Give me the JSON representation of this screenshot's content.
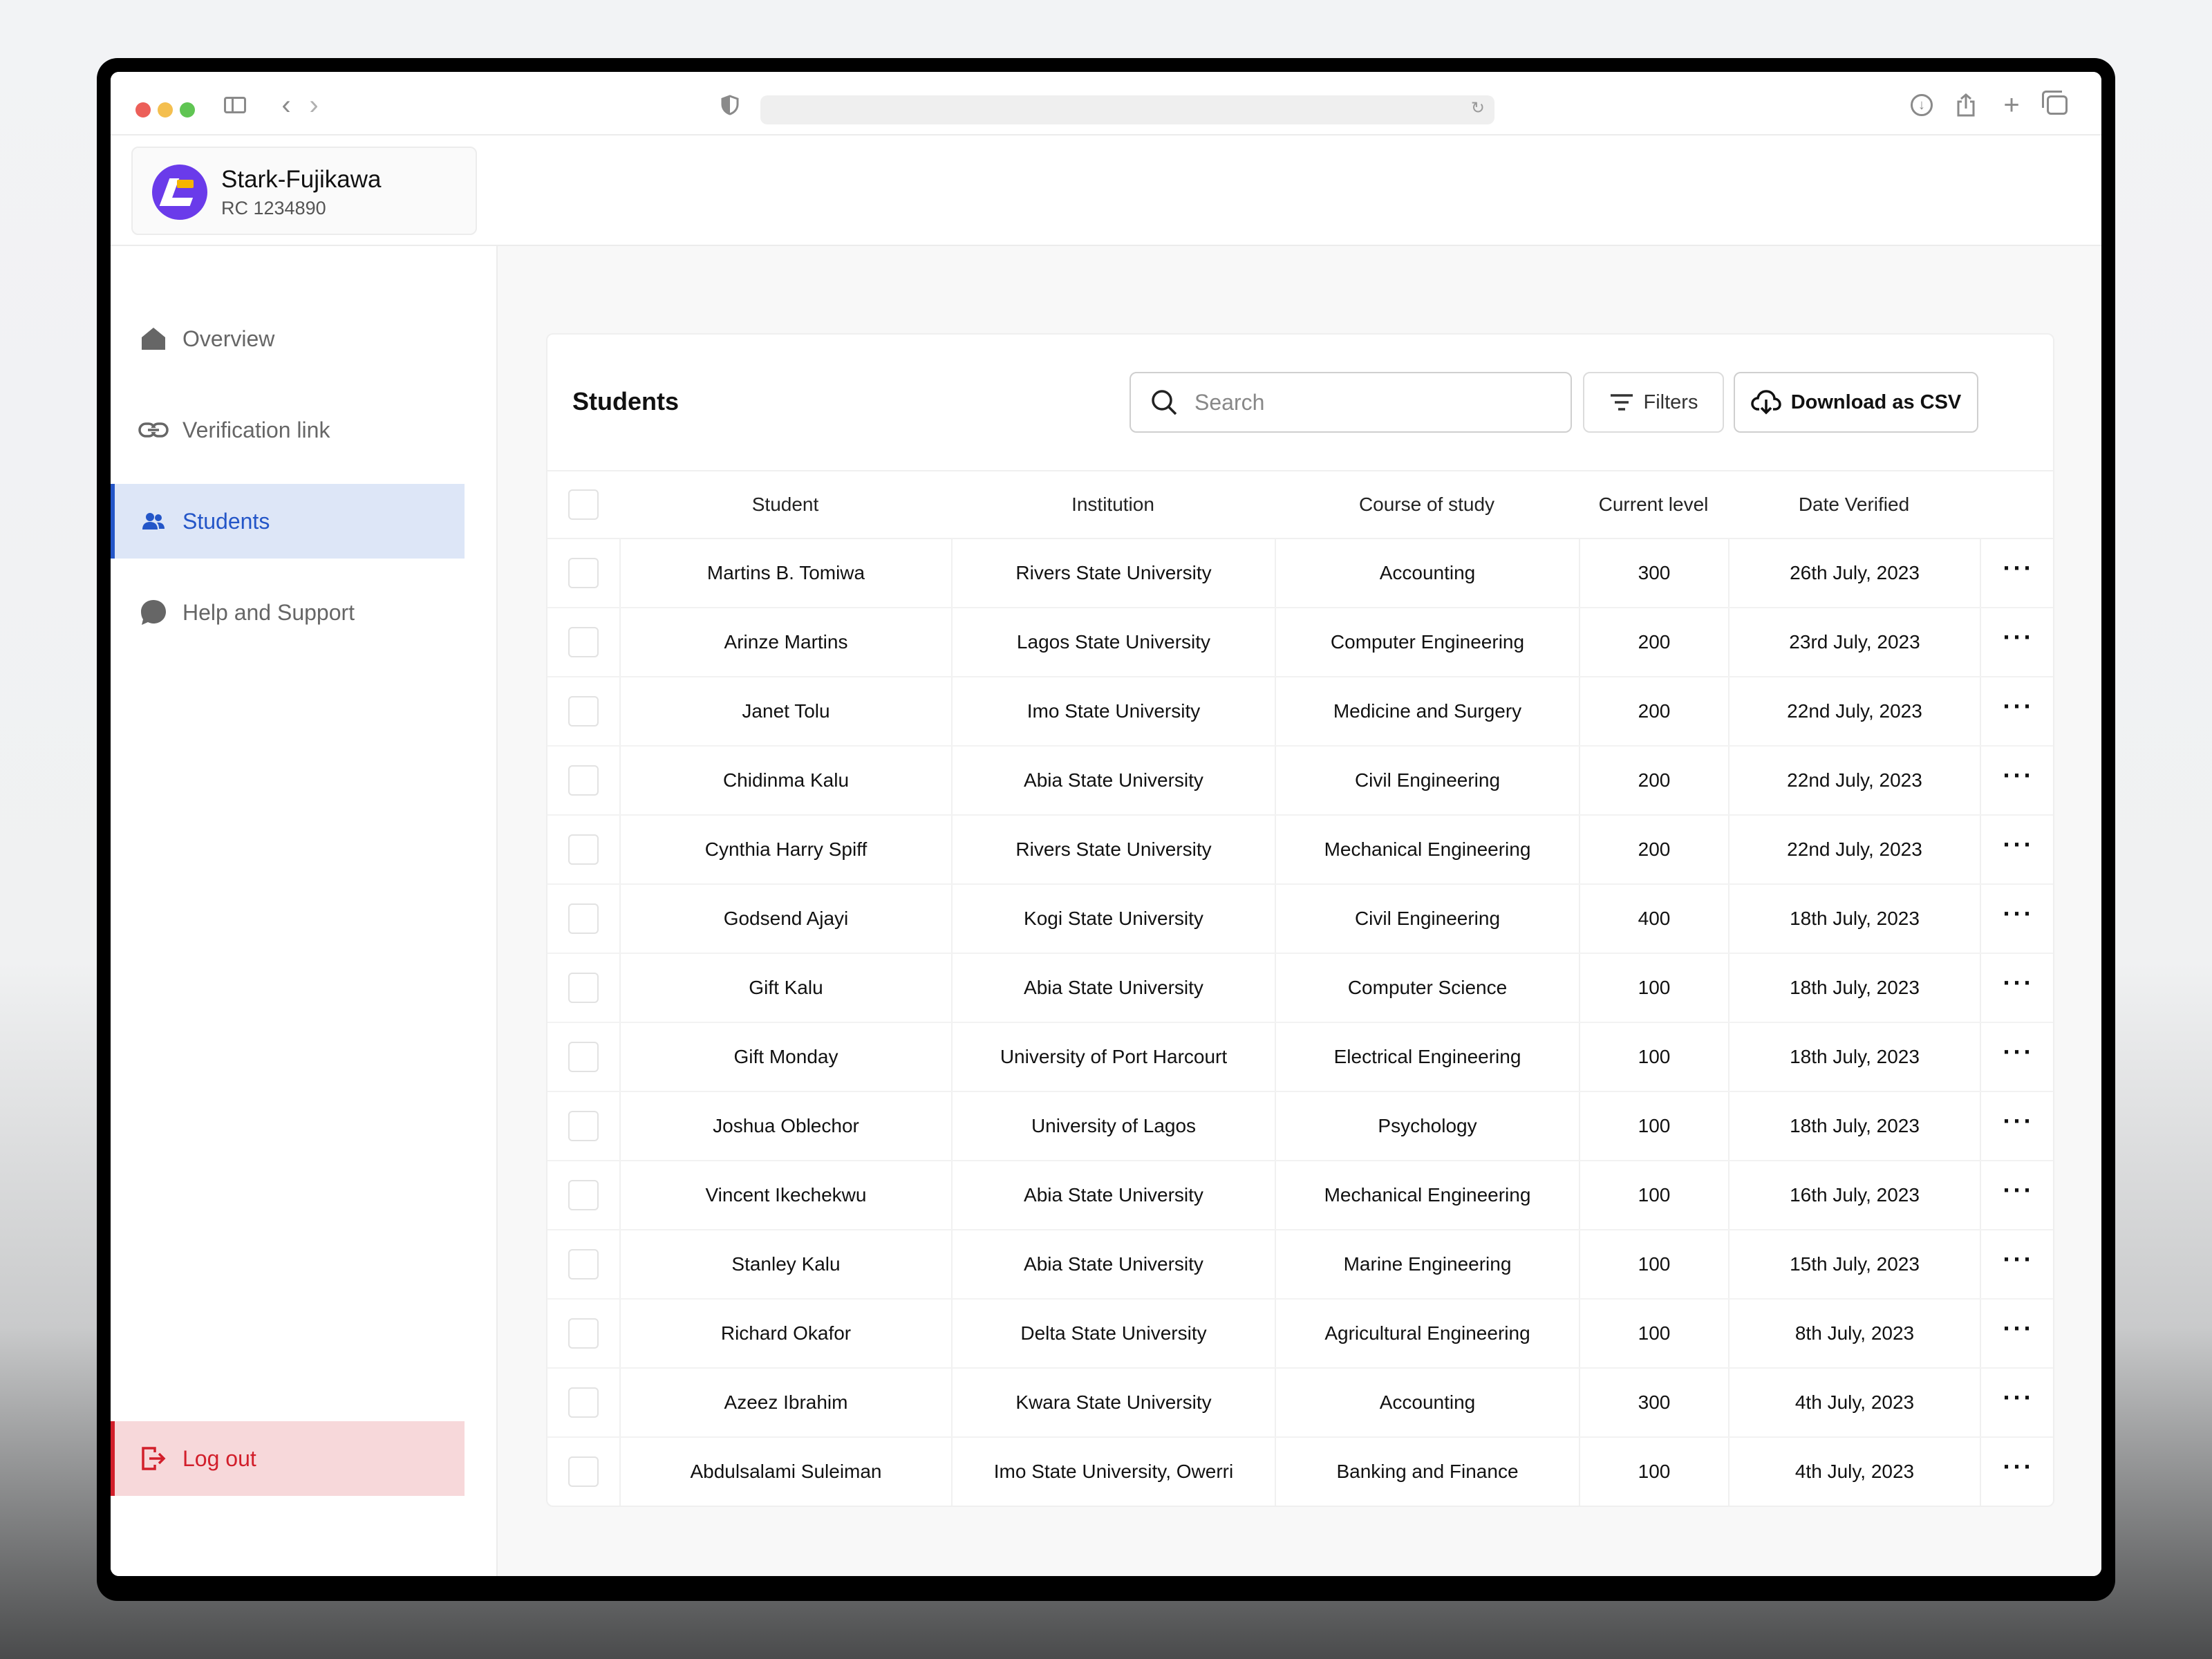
{
  "org": {
    "name": "Stark-Fujikawa",
    "rc": "RC 1234890"
  },
  "sidebar": {
    "items": [
      {
        "label": "Overview",
        "icon": "home-icon"
      },
      {
        "label": "Verification link",
        "icon": "link-icon"
      },
      {
        "label": "Students",
        "icon": "users-icon",
        "active": true
      },
      {
        "label": "Help and Support",
        "icon": "chat-bubble-icon"
      }
    ],
    "logout": {
      "label": "Log out",
      "icon": "logout-icon"
    }
  },
  "main": {
    "title": "Students",
    "search": {
      "placeholder": "Search",
      "value": ""
    },
    "filters_label": "Filters",
    "csv_label": "Download as CSV"
  },
  "table": {
    "columns": [
      "Student",
      "Institution",
      "Course of study",
      "Current level",
      "Date Verified"
    ],
    "rows": [
      [
        "Martins B. Tomiwa",
        "Rivers State University",
        "Accounting",
        "300",
        "26th July, 2023"
      ],
      [
        "Arinze Martins",
        "Lagos State University",
        "Computer Engineering",
        "200",
        "23rd July, 2023"
      ],
      [
        "Janet Tolu",
        "Imo State University",
        "Medicine and Surgery",
        "200",
        "22nd July, 2023"
      ],
      [
        "Chidinma Kalu",
        "Abia State University",
        "Civil Engineering",
        "200",
        "22nd July, 2023"
      ],
      [
        "Cynthia Harry Spiff",
        "Rivers State University",
        "Mechanical Engineering",
        "200",
        "22nd July, 2023"
      ],
      [
        "Godsend Ajayi",
        "Kogi State University",
        "Civil Engineering",
        "400",
        "18th July, 2023"
      ],
      [
        "Gift Kalu",
        "Abia State University",
        "Computer Science",
        "100",
        "18th July, 2023"
      ],
      [
        "Gift Monday",
        "University of Port Harcourt",
        "Electrical Engineering",
        "100",
        "18th July, 2023"
      ],
      [
        "Joshua Oblechor",
        "University of Lagos",
        "Psychology",
        "100",
        "18th July, 2023"
      ],
      [
        "Vincent Ikechekwu",
        "Abia State University",
        "Mechanical Engineering",
        "100",
        "16th July, 2023"
      ],
      [
        "Stanley Kalu",
        "Abia State University",
        "Marine Engineering",
        "100",
        "15th July, 2023"
      ],
      [
        "Richard Okafor",
        "Delta State University",
        "Agricultural Engineering",
        "100",
        "8th July, 2023"
      ],
      [
        "Azeez Ibrahim",
        "Kwara State University",
        "Accounting",
        "300",
        "4th July, 2023"
      ],
      [
        "Abdulsalami Suleiman",
        "Imo State University, Owerri",
        "Banking and Finance",
        "100",
        "4th July, 2023"
      ]
    ],
    "more_label": "···"
  },
  "colors": {
    "accent": "#2456c8",
    "danger": "#d21f2b",
    "brand": "#6a3bea"
  }
}
